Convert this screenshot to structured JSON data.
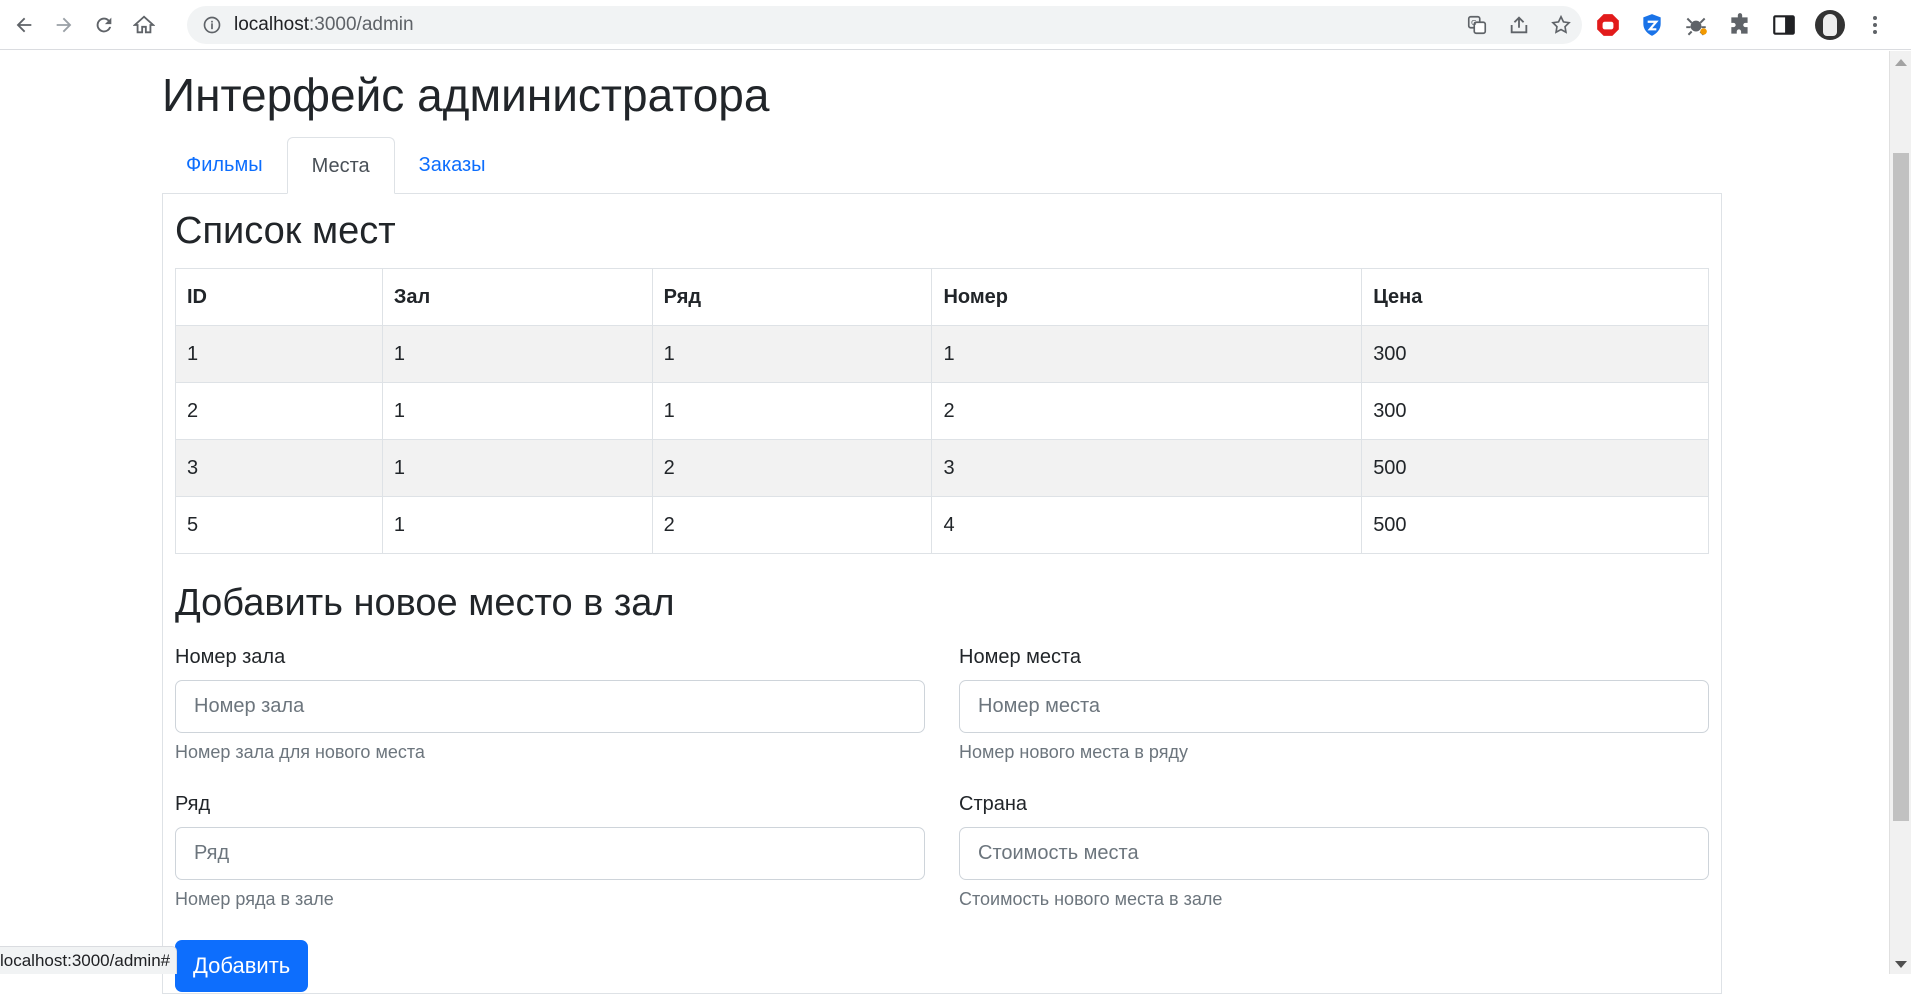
{
  "browser": {
    "url_host": "localhost",
    "url_path": ":3000/admin",
    "status_url": "localhost:3000/admin#"
  },
  "page": {
    "title": "Интерфейс администратора",
    "tabs": [
      {
        "label": "Фильмы",
        "active": false
      },
      {
        "label": "Места",
        "active": true
      },
      {
        "label": "Заказы",
        "active": false
      }
    ]
  },
  "seats": {
    "heading": "Список мест",
    "columns": [
      "ID",
      "Зал",
      "Ряд",
      "Номер",
      "Цена"
    ],
    "rows": [
      [
        "1",
        "1",
        "1",
        "1",
        "300"
      ],
      [
        "2",
        "1",
        "1",
        "2",
        "300"
      ],
      [
        "3",
        "1",
        "2",
        "3",
        "500"
      ],
      [
        "5",
        "1",
        "2",
        "4",
        "500"
      ]
    ]
  },
  "form": {
    "heading": "Добавить новое место в зал",
    "hall": {
      "label": "Номер зала",
      "placeholder": "Номер зала",
      "help": "Номер зала для нового места"
    },
    "seat": {
      "label": "Номер места",
      "placeholder": "Номер места",
      "help": "Номер нового места в ряду"
    },
    "row": {
      "label": "Ряд",
      "placeholder": "Ряд",
      "help": "Номер ряда в зале"
    },
    "price": {
      "label": "Страна",
      "placeholder": "Стоимость места",
      "help": "Стоимость нового места в зале"
    },
    "submit_label": "Добавить"
  },
  "colors": {
    "primary": "#0d6efd",
    "stripe": "#f2f2f2",
    "border": "#dee2e6"
  }
}
